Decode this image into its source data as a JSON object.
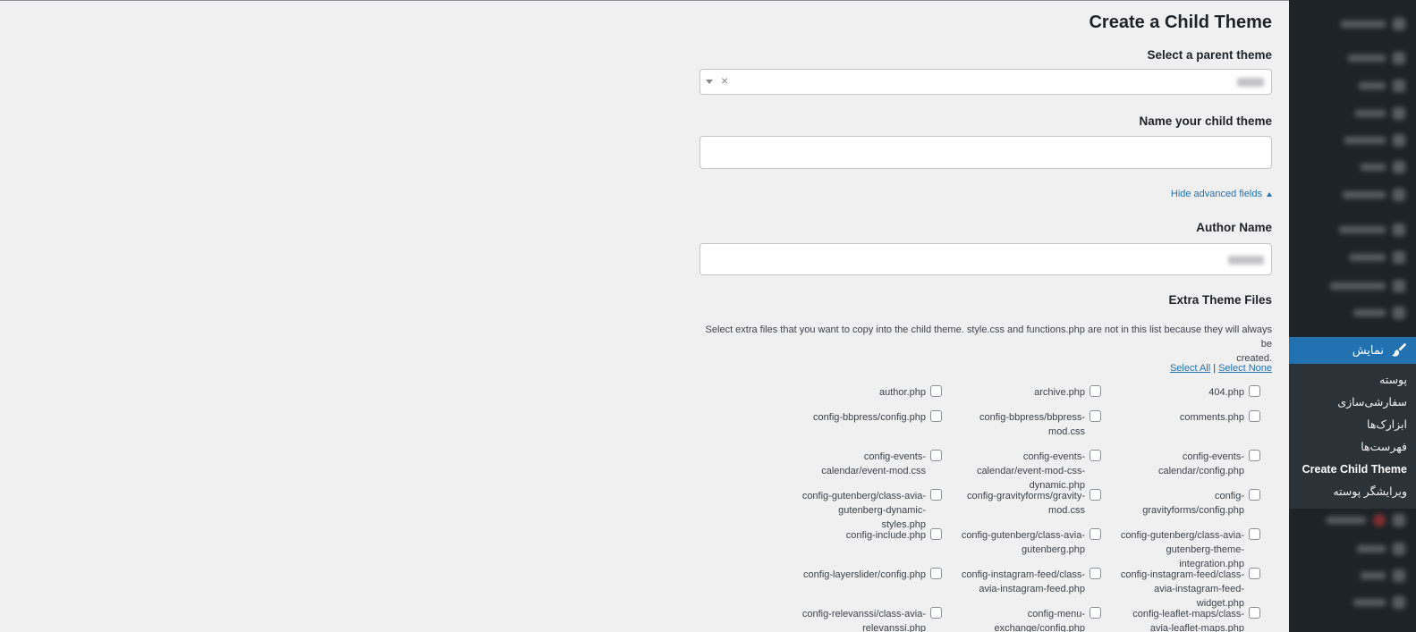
{
  "page": {
    "title": "Create a Child Theme",
    "select_parent_label": "Select a parent theme",
    "name_child_label": "Name your child theme",
    "hide_advanced": "Hide advanced fields",
    "author_label": "Author Name",
    "extra_files_label": "Extra Theme Files",
    "description_line1": "Select extra files that you want to copy into the child theme. style.css and functions.php are not in this list because they will always be",
    "description_line2": "created.",
    "select_all": "Select All",
    "select_separator": "|",
    "select_none": "Select None",
    "clear_symbol": "×"
  },
  "files": [
    [
      "404.php",
      "archive.php",
      "author.php"
    ],
    [
      "comments.php",
      "config-bbpress/bbpress-mod.css",
      "config-bbpress/config.php"
    ],
    [
      "config-events-calendar/config.php",
      "config-events-calendar/event-mod-css-dynamic.php",
      "config-events-calendar/event-mod.css"
    ],
    [
      "config-gravityforms/config.php",
      "config-gravityforms/gravity-mod.css",
      "config-gutenberg/class-avia-gutenberg-dynamic-styles.php"
    ],
    [
      "config-gutenberg/class-avia-gutenberg-theme-integration.php",
      "config-gutenberg/class-avia-gutenberg.php",
      "config-include.php"
    ],
    [
      "config-instagram-feed/class-avia-instagram-feed-widget.php",
      "config-instagram-feed/class-avia-instagram-feed.php",
      "config-layerslider/config.php"
    ],
    [
      "config-leaflet-maps/class-avia-leaflet-maps.php",
      "config-menu-exchange/config.php",
      "config-relevanssi/class-avia-relevanssi.php"
    ]
  ],
  "sidebar": {
    "appearance_label": "نمایش",
    "submenu": [
      {
        "label": "پوسته",
        "current": false
      },
      {
        "label": "سفارشی‌سازی",
        "current": false
      },
      {
        "label": "ابزارک‌ها",
        "current": false
      },
      {
        "label": "فهرست‌ها",
        "current": false
      },
      {
        "label": "Create Child Theme",
        "current": true
      },
      {
        "label": "ویرایشگر پوسته",
        "current": false
      }
    ]
  },
  "colors": {
    "sidebar_bg": "#1d2327",
    "submenu_bg": "#2c3338",
    "accent": "#2271b1",
    "page_bg": "#f0f0f1"
  },
  "icons": {
    "appearance": "paintbrush-icon"
  }
}
